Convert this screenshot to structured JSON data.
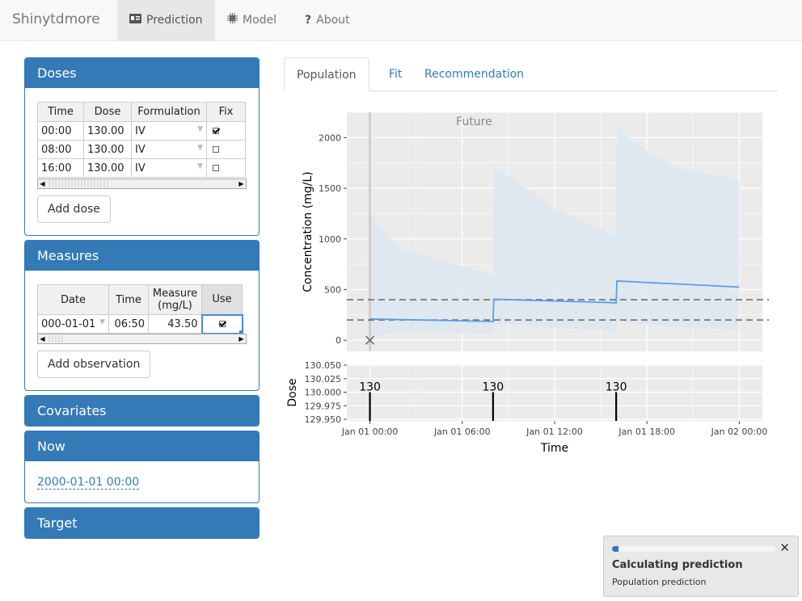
{
  "navbar": {
    "brand": "Shinytdmore",
    "tabs": [
      {
        "label": "Prediction",
        "icon": "id-card-icon"
      },
      {
        "label": "Model",
        "icon": "chip-icon"
      },
      {
        "label": "About",
        "icon": "question-icon"
      }
    ]
  },
  "doses": {
    "title": "Doses",
    "columns": [
      "Time",
      "Dose",
      "Formulation",
      "Fix"
    ],
    "rows": [
      {
        "time": "00:00",
        "dose": "130.00",
        "formulation": "IV",
        "fix": true
      },
      {
        "time": "08:00",
        "dose": "130.00",
        "formulation": "IV",
        "fix": false
      },
      {
        "time": "16:00",
        "dose": "130.00",
        "formulation": "IV",
        "fix": false
      }
    ],
    "add_label": "Add dose"
  },
  "measures": {
    "title": "Measures",
    "columns": [
      "Date",
      "Time",
      "Measure (mg/L)",
      "Use"
    ],
    "rows": [
      {
        "date": "000-01-01",
        "time": "06:50",
        "measure": "43.50",
        "use": true
      }
    ],
    "add_label": "Add observation"
  },
  "covariates": {
    "title": "Covariates"
  },
  "now": {
    "title": "Now",
    "value": "2000-01-01 00:00"
  },
  "target": {
    "title": "Target"
  },
  "main_tabs": [
    "Population",
    "Fit",
    "Recommendation"
  ],
  "chart_data": [
    {
      "type": "line",
      "annotation": "Future",
      "xlabel": "",
      "ylabel": "Concentration (mg/L)",
      "yticks": [
        0,
        500,
        1000,
        1500,
        2000
      ],
      "ylim": [
        -110,
        2250
      ],
      "xlim_hours": [
        -1.5,
        25.5
      ],
      "grid": true,
      "series": [
        {
          "type": "line",
          "x": [
            0,
            0.1,
            8,
            8.05,
            16,
            16.05,
            24
          ],
          "y": [
            210,
            210,
            185,
            405,
            370,
            585,
            525
          ],
          "color": "#56a0e8"
        },
        {
          "type": "band",
          "x": [
            0,
            2,
            4,
            8,
            8.05,
            9,
            12,
            16,
            16.05,
            17,
            20,
            24
          ],
          "upper": [
            1260,
            890,
            820,
            640,
            1740,
            1620,
            1300,
            1030,
            2150,
            1960,
            1700,
            1580
          ],
          "lower": [
            40,
            80,
            80,
            60,
            150,
            160,
            120,
            90,
            200,
            170,
            130,
            100
          ],
          "color": "#dde6f0"
        }
      ],
      "hlines": [
        400,
        200
      ],
      "marker": {
        "x": 0,
        "y": 0,
        "symbol": "x"
      }
    },
    {
      "type": "bar",
      "xlabel": "Time",
      "ylabel": "Dose",
      "yticks": [
        "130.050",
        "130.025",
        "130.000",
        "129.975",
        "129.950"
      ],
      "xticks": [
        "Jan 01 00:00",
        "Jan 01 06:00",
        "Jan 01 12:00",
        "Jan 01 18:00",
        "Jan 02 00:00"
      ],
      "bars": [
        {
          "x": 0,
          "label": "130"
        },
        {
          "x": 8,
          "label": "130"
        },
        {
          "x": 16,
          "label": "130"
        }
      ]
    }
  ],
  "notification": {
    "title": "Calculating prediction",
    "detail": "Population prediction",
    "progress": 0.02,
    "close": "✕"
  },
  "colors": {
    "primary": "#337ab7",
    "navbar_bg": "#f8f8f8",
    "line": "#56a0e8",
    "band": "#dde6f0",
    "panel_bg": "#ebebeb"
  }
}
